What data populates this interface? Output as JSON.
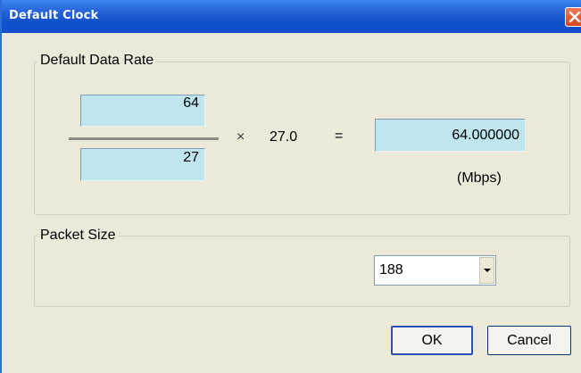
{
  "window": {
    "title": "Default Clock"
  },
  "default_data_rate": {
    "group_label": "Default Data Rate",
    "numerator": "64",
    "denominator": "27",
    "multiply_sign": "×",
    "multiplier": "27.0",
    "equals_sign": "=",
    "result": "64.000000",
    "unit": "(Mbps)"
  },
  "packet_size": {
    "group_label": "Packet Size",
    "selected_value": "188"
  },
  "buttons": {
    "ok_label": "OK",
    "cancel_label": "Cancel"
  },
  "icons": {
    "close": "close-icon",
    "dropdown": "chevron-down-icon"
  },
  "colors": {
    "titlebar": "#0e4fc8",
    "field_bg": "#bfe6ef",
    "window_bg": "#ece9d8",
    "close_button": "#d6451f"
  }
}
